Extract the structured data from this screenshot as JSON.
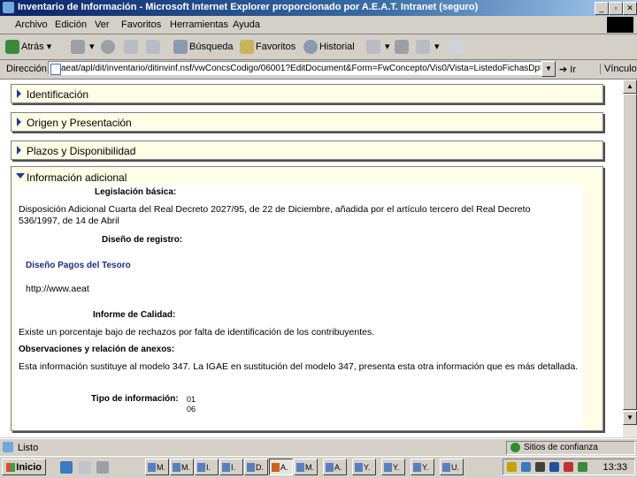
{
  "window": {
    "title": "Inventario de Información - Microsoft Internet Explorer proporcionado por A.E.A.T. Intranet (seguro)",
    "controls": [
      "_",
      "▫",
      "✕"
    ]
  },
  "menu": [
    "Archivo",
    "Edición",
    "Ver",
    "Favoritos",
    "Herramientas",
    "Ayuda"
  ],
  "toolbar": {
    "back": "Atrás",
    "search": "Búsqueda",
    "favorites": "Favoritos",
    "history": "Historial"
  },
  "address": {
    "label": "Dirección",
    "url": "aeat/apl/dit/inventario/ditinvinf.nsf/vwConcsCodigo/06001?EditDocument&Form=FwConcepto/Vis0/Vista=ListedoFichasDpto&",
    "go": "Ir",
    "links": "Vínculos"
  },
  "sections": [
    {
      "title": "Identificación"
    },
    {
      "title": "Origen y Presentación"
    },
    {
      "title": "Plazos y Disponibilidad"
    }
  ],
  "info": {
    "title": "Información adicional",
    "legislacion_label": "Legislación básica:",
    "legislacion_text": "Disposición Adicional Cuarta del Real Decreto 2027/95, de 22 de Diciembre, añadida por el artículo tercero del Real Decreto 536/1997, de 14 de Abril",
    "diseno_label": "Diseño de registro:",
    "diseno_link": "Diseño Pagos del Tesoro",
    "url_text": "http://www.aeat",
    "calidad_label": "Informe de Calidad:",
    "calidad_text": "Existe un porcentaje bajo de rechazos por falta de identificación de los contribuyentes.",
    "observ_label": "Observaciones y relación de anexos:",
    "observ_text": "Esta información sustituye al modelo 347. La IGAE en sustitución del modelo 347, presenta esta otra información que es más detallada.",
    "tipo_label": "Tipo de información:",
    "tipo_values": [
      "01",
      "06"
    ]
  },
  "status": {
    "text": "Listo",
    "zone": "Sitios de confianza"
  },
  "taskbar": {
    "start": "Inicio",
    "tasks": [
      "M.",
      "M.",
      "I.",
      "I.",
      "D.",
      "A.",
      "M.",
      "A.",
      "Y.",
      "Y.",
      "Y.",
      "U."
    ],
    "clock": "13:33"
  }
}
